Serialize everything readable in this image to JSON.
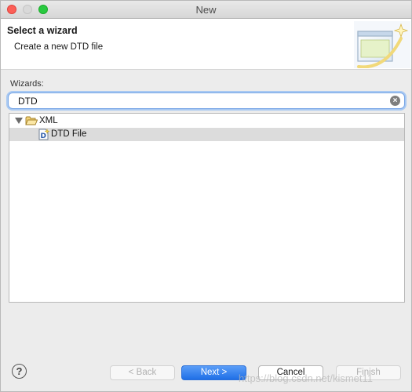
{
  "window": {
    "title": "New"
  },
  "banner": {
    "title": "Select a wizard",
    "message": "Create a new DTD file",
    "graphic_icon": "wizard-banner-icon"
  },
  "wizards": {
    "label": "Wizards:",
    "filter_value": "DTD",
    "clear_icon": "clear-search-icon"
  },
  "tree": {
    "items": [
      {
        "label": "XML",
        "icon": "folder-open-icon",
        "expanded": true,
        "level": 0
      },
      {
        "label": "DTD File",
        "icon": "dtd-file-icon",
        "selected": true,
        "level": 1
      }
    ]
  },
  "buttons": {
    "help": "?",
    "back": "< Back",
    "next": "Next >",
    "cancel": "Cancel",
    "finish": "Finish"
  },
  "watermark": "https://blog.csdn.net/kismet11",
  "colors": {
    "accent": "#1f6fe6",
    "selection": "#dcdcdc",
    "close": "#fc5f57",
    "maximize": "#29c940"
  }
}
